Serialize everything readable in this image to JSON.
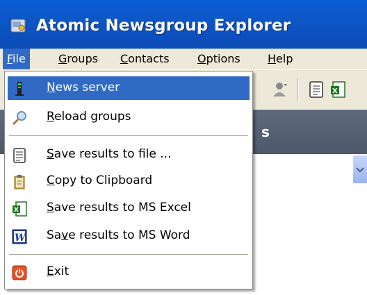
{
  "window": {
    "title": "Atomic Newsgroup Explorer"
  },
  "menubar": {
    "file": {
      "mn": "F",
      "rest": "ile"
    },
    "groups": {
      "mn": "G",
      "rest": "roups"
    },
    "contacts": {
      "mn": "C",
      "rest": "ontacts"
    },
    "options": {
      "mn": "O",
      "rest": "ptions"
    },
    "help": {
      "mn": "H",
      "rest": "elp"
    }
  },
  "panel": {
    "partial_text": "s"
  },
  "file_menu": {
    "news_server": {
      "mn": "N",
      "rest": "ews server"
    },
    "reload_groups": {
      "mn": "R",
      "rest": "eload groups"
    },
    "save_file": {
      "mn": "S",
      "rest": "ave results to file ..."
    },
    "copy_clipboard": {
      "mn": "C",
      "rest": "opy to Clipboard"
    },
    "save_excel": {
      "mn": "S",
      "rest": "ave results to MS Excel"
    },
    "save_word": {
      "pre": "Sa",
      "mn": "v",
      "rest": "e results to MS Word"
    },
    "exit": {
      "mn": "E",
      "rest": "xit"
    }
  },
  "colors": {
    "highlight": "#316ac5",
    "titlebar": "#0b58cf",
    "menubar": "#ece9d8"
  },
  "icons": [
    "app-icon",
    "server-icon",
    "search-icon",
    "notepad-icon",
    "clipboard-icon",
    "excel-icon",
    "word-icon",
    "power-icon"
  ]
}
